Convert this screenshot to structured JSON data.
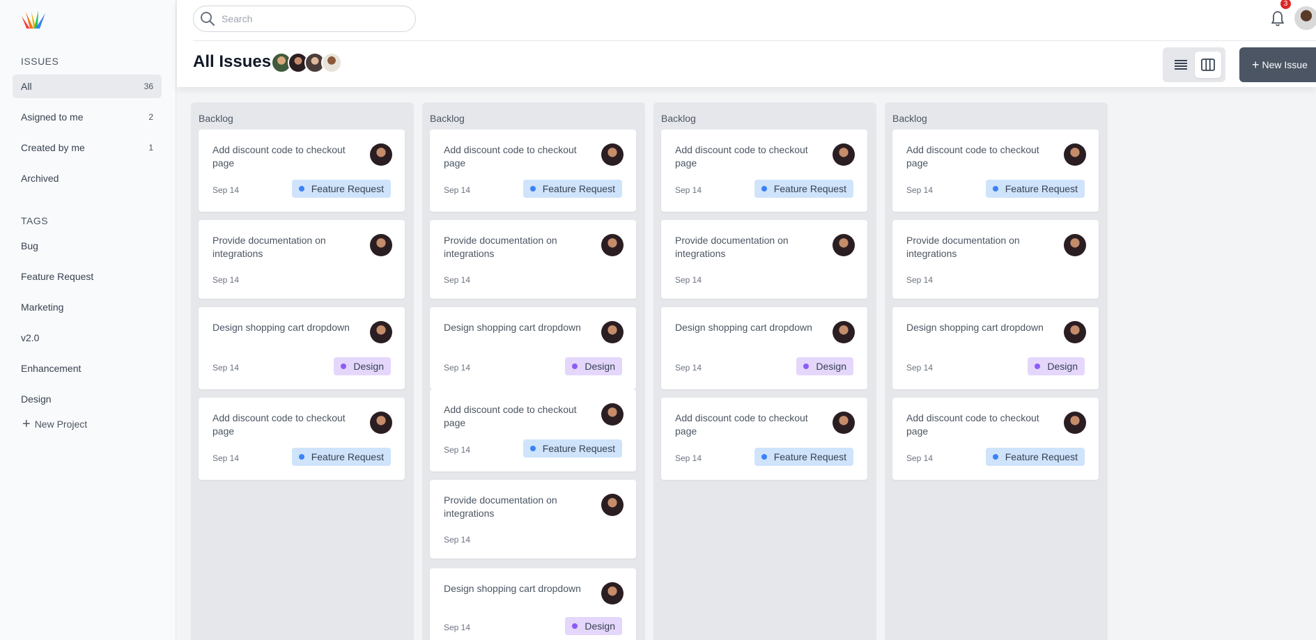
{
  "sidebar": {
    "issues_title": "Issues",
    "issues": [
      {
        "label": "All",
        "count": "36"
      },
      {
        "label": "Asigned to me",
        "count": "2"
      },
      {
        "label": "Created by me",
        "count": "1"
      },
      {
        "label": "Archived",
        "count": ""
      }
    ],
    "tags_title": "Tags",
    "tags": [
      "Bug",
      "Feature Request",
      "Marketing",
      "v2.0",
      "Enhancement",
      "Design"
    ],
    "new_project": "New Project"
  },
  "header": {
    "search_placeholder": "Search",
    "page_title": "All Issues",
    "notification_count": "3",
    "new_issue": "New Issue"
  },
  "board": {
    "columns": [
      {
        "title": "Backlog",
        "cards": [
          {
            "title": "Add discount code to checkout page",
            "date": "Sep 14",
            "tag": "Feature Request"
          },
          {
            "title": "Provide documentation on integrations",
            "date": "Sep 14",
            "tag": ""
          },
          {
            "title": "Design shopping cart dropdown",
            "date": "Sep 14",
            "tag": "Design"
          },
          {
            "title": "Add discount code to checkout page",
            "date": "Sep 14",
            "tag": "Feature Request"
          }
        ]
      },
      {
        "title": "Backlog",
        "cards": [
          {
            "title": "Add discount code to checkout page",
            "date": "Sep 14",
            "tag": "Feature Request"
          },
          {
            "title": "Provide documentation on integrations",
            "date": "Sep 14",
            "tag": ""
          },
          {
            "title": "Design shopping cart dropdown",
            "date": "Sep 14",
            "tag": "Design"
          },
          {
            "title": "Add discount code to checkout page",
            "date": "Sep 14",
            "tag": "Feature Request"
          },
          {
            "title": "Provide documentation on integrations",
            "date": "Sep 14",
            "tag": ""
          },
          {
            "title": "Design shopping cart dropdown",
            "date": "Sep 14",
            "tag": "Design"
          }
        ]
      },
      {
        "title": "Backlog",
        "cards": [
          {
            "title": "Add discount code to checkout page",
            "date": "Sep 14",
            "tag": "Feature Request"
          },
          {
            "title": "Provide documentation on integrations",
            "date": "Sep 14",
            "tag": ""
          },
          {
            "title": "Design shopping cart dropdown",
            "date": "Sep 14",
            "tag": "Design"
          },
          {
            "title": "Add discount code to checkout page",
            "date": "Sep 14",
            "tag": "Feature Request"
          }
        ]
      },
      {
        "title": "Backlog",
        "cards": [
          {
            "title": "Add discount code to checkout page",
            "date": "Sep 14",
            "tag": "Feature Request"
          },
          {
            "title": "Provide documentation on integrations",
            "date": "Sep 14",
            "tag": ""
          },
          {
            "title": "Design shopping cart dropdown",
            "date": "Sep 14",
            "tag": "Design"
          },
          {
            "title": "Add discount code to checkout page",
            "date": "Sep 14",
            "tag": "Feature Request"
          }
        ]
      }
    ]
  },
  "colors": {
    "sidebar_bg": "#f9fafb",
    "board_bg": "#f3f4f6",
    "column_bg": "#e5e7eb",
    "feature_tag_bg": "#cfe3fb",
    "feature_tag_dot": "#3b82f6",
    "design_tag_bg": "#e4d7fb",
    "design_tag_dot": "#8b5cf6",
    "new_issue_bg": "#4b5563",
    "badge": "#dc2626"
  },
  "icons": {
    "logo": "app-logo",
    "search": "search-icon",
    "bell": "bell-icon",
    "list_view": "list-view-icon",
    "board_view": "board-view-icon",
    "plus": "plus-icon"
  }
}
